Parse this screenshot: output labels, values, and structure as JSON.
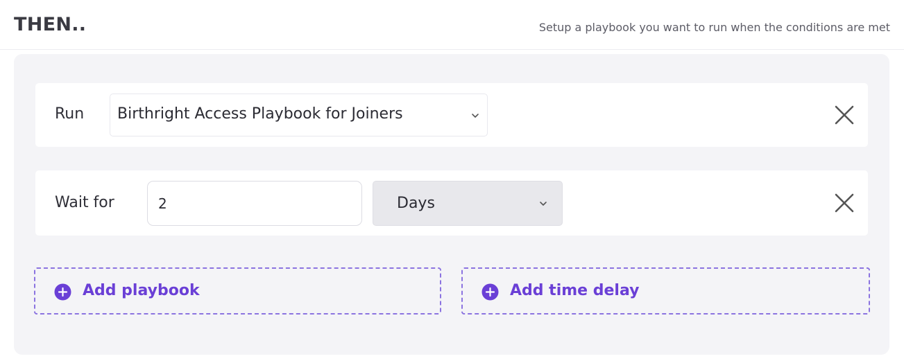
{
  "header": {
    "title": "THEN..",
    "subtitle": "Setup a playbook you want to run when the conditions are met"
  },
  "run_row": {
    "label": "Run",
    "playbook_selected": "Birthright Access Playbook for Joiners",
    "dropdown_icon": "chevron-down-icon",
    "remove_icon": "close-icon"
  },
  "wait_row": {
    "label": "Wait for",
    "amount_value": "2",
    "unit_selected": "Days",
    "dropdown_icon": "chevron-down-icon",
    "remove_icon": "close-icon"
  },
  "actions": {
    "add_playbook_label": "Add playbook",
    "add_time_delay_label": "Add time delay",
    "add_icon": "plus-circle-icon"
  },
  "colors": {
    "accent": "#6a3fd6",
    "dashed_border": "#8b73e0",
    "panel_background": "#f4f4f7",
    "unit_select_background": "#e8e8ec"
  }
}
